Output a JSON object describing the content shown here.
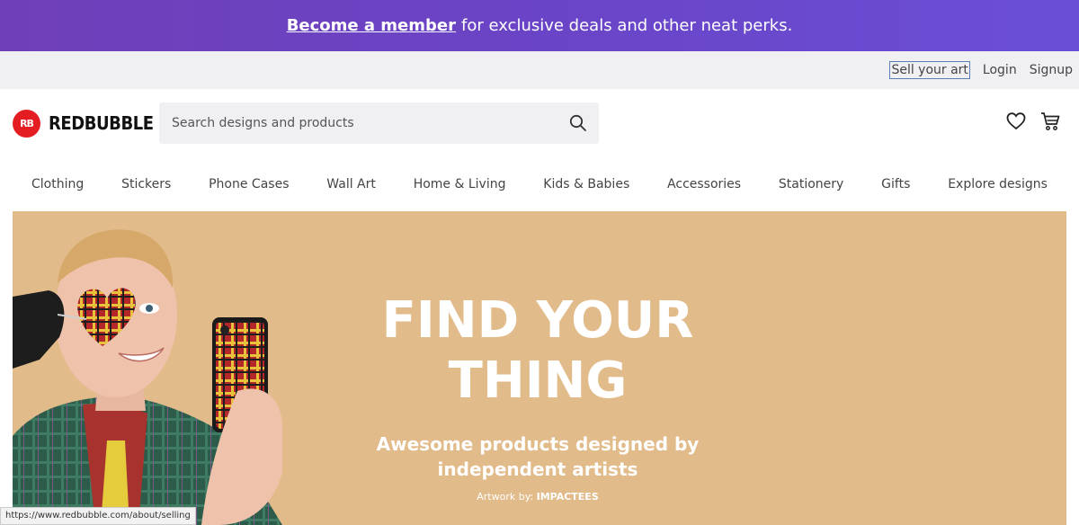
{
  "promo": {
    "link": "Become a member",
    "text": "for exclusive deals and other neat perks."
  },
  "utility": {
    "sell": "Sell your art",
    "login": "Login",
    "signup": "Signup"
  },
  "header": {
    "logo_mark": "RB",
    "logo_text": "REDBUBBLE",
    "search_placeholder": "Search designs and products"
  },
  "nav": {
    "items": [
      "Clothing",
      "Stickers",
      "Phone Cases",
      "Wall Art",
      "Home & Living",
      "Kids & Babies",
      "Accessories",
      "Stationery",
      "Gifts",
      "Explore designs"
    ]
  },
  "hero": {
    "headline_1": "FIND YOUR",
    "headline_2": "THING",
    "sub_1": "Awesome products designed by",
    "sub_2": "independent artists",
    "credit_label": "Artwork by:",
    "credit_artist": "IMPACTEES"
  },
  "status_url": "https://www.redbubble.com/about/selling",
  "colors": {
    "brand": "#e41d23",
    "promo": "#6a45c8",
    "hero_bg": "#e2bb8a"
  }
}
